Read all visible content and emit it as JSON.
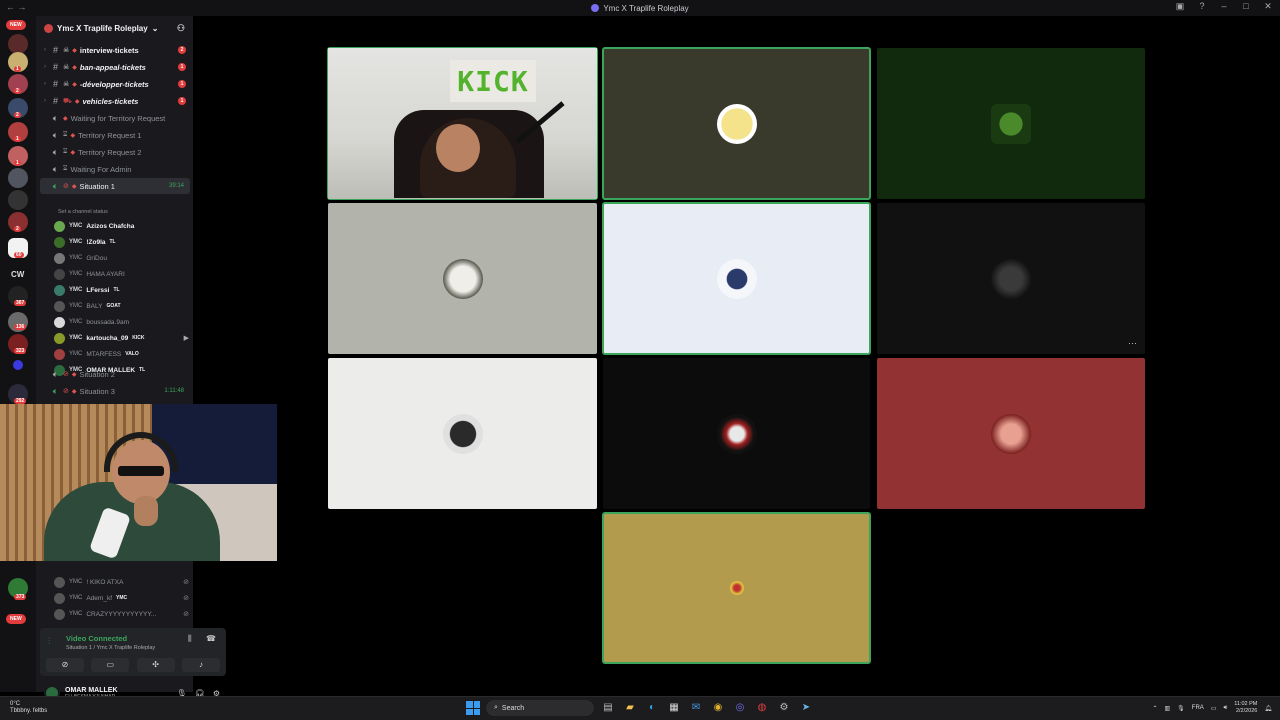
{
  "window": {
    "title": "Ymc X Traplife Roleplay",
    "nav": "←  →"
  },
  "guilds": {
    "new_label": "NEW",
    "cw_label": "CW",
    "badges": [
      "1",
      "2",
      "2",
      "1",
      "1",
      "2",
      "60",
      "367",
      "136",
      "323",
      "292",
      "373"
    ]
  },
  "server": {
    "name": "Ymc X Traplife Roleplay"
  },
  "channels": [
    {
      "type": "text",
      "name": "interview-tickets",
      "badge": "2"
    },
    {
      "type": "text",
      "name": "ban-appeal-tickets",
      "badge": "1"
    },
    {
      "type": "text",
      "name": "-développer-tickets",
      "badge": "1"
    },
    {
      "type": "text",
      "name": "vehicles-tickets",
      "badge": "1"
    },
    {
      "type": "voice",
      "name": "Waiting for Territory Request"
    },
    {
      "type": "voice",
      "name": "Territory Request 1"
    },
    {
      "type": "voice",
      "name": "Territory Request 2"
    },
    {
      "type": "voice",
      "name": "Waiting For Admin"
    },
    {
      "type": "voice",
      "name": "Situation 1",
      "time": "39:14",
      "active": true
    }
  ],
  "status_hint": "Set a channel status",
  "voice_users": [
    {
      "tag": "YMC",
      "name": "Azizos Chafcha",
      "extra": "",
      "dim": false,
      "color": "#6aa84f"
    },
    {
      "tag": "YMC",
      "name": "!Zo9la",
      "extra": "TL",
      "dim": false,
      "color": "#3c6e2a"
    },
    {
      "tag": "YMC",
      "name": "GriDou",
      "extra": "",
      "dim": true,
      "color": "#777777"
    },
    {
      "tag": "YMC",
      "name": "HAMA AYARI",
      "extra": "",
      "dim": true,
      "color": "#444444"
    },
    {
      "tag": "YMC",
      "name": "LFerssi",
      "extra": "TL",
      "dim": false,
      "color": "#3a7a6a"
    },
    {
      "tag": "YMC",
      "name": "BALY",
      "extra": "GOAT",
      "dim": true,
      "color": "#555555"
    },
    {
      "tag": "YMC",
      "name": "boussada.9am",
      "extra": "",
      "dim": true,
      "color": "#d9d9d9"
    },
    {
      "tag": "YMC",
      "name": "kartoucha_09",
      "extra": "KICK",
      "dim": false,
      "color": "#8a9a2a",
      "camera": true
    },
    {
      "tag": "YMC",
      "name": "MTARFESS",
      "extra": "VALO",
      "dim": true,
      "color": "#a04040"
    },
    {
      "tag": "YMC",
      "name": "OMAR MALLEK",
      "extra": "TL",
      "dim": false,
      "color": "#2b6b3e"
    }
  ],
  "more_channels": [
    {
      "name": "Situation 2",
      "time": ""
    },
    {
      "name": "Situation 3",
      "time": "1:11:48"
    }
  ],
  "lower_users": [
    {
      "tag": "YMC",
      "name": "! KIKO ATXA",
      "extra": ""
    },
    {
      "tag": "YMC",
      "name": "Adem_kf",
      "extra": "YMC"
    },
    {
      "tag": "YMC",
      "name": "CRAZYYYYYYYYYYY...",
      "extra": ""
    }
  ],
  "voice_panel": {
    "status": "Video Connected",
    "channel": "Situation 1 / Ymc X Traplife Roleplay"
  },
  "user": {
    "name": "OMAR MALLEK",
    "status": "ELI BESMA YJI NHAR ..."
  },
  "stage": {
    "kick_sign": "KICK",
    "tile_colors": [
      "#3a3a2c",
      "#112a0d",
      "#b2b3ab",
      "#e8ecf4",
      "#111111",
      "#ececea",
      "#0c0c0c",
      "#933232",
      "#b29b4c"
    ],
    "more_icon": "···"
  },
  "taskbar": {
    "temp": "0°C",
    "weather": "Tbbbny. feltbs",
    "search": "Search",
    "lang": "FRA",
    "time": "11:02 PM",
    "date": "2/2/2026"
  }
}
